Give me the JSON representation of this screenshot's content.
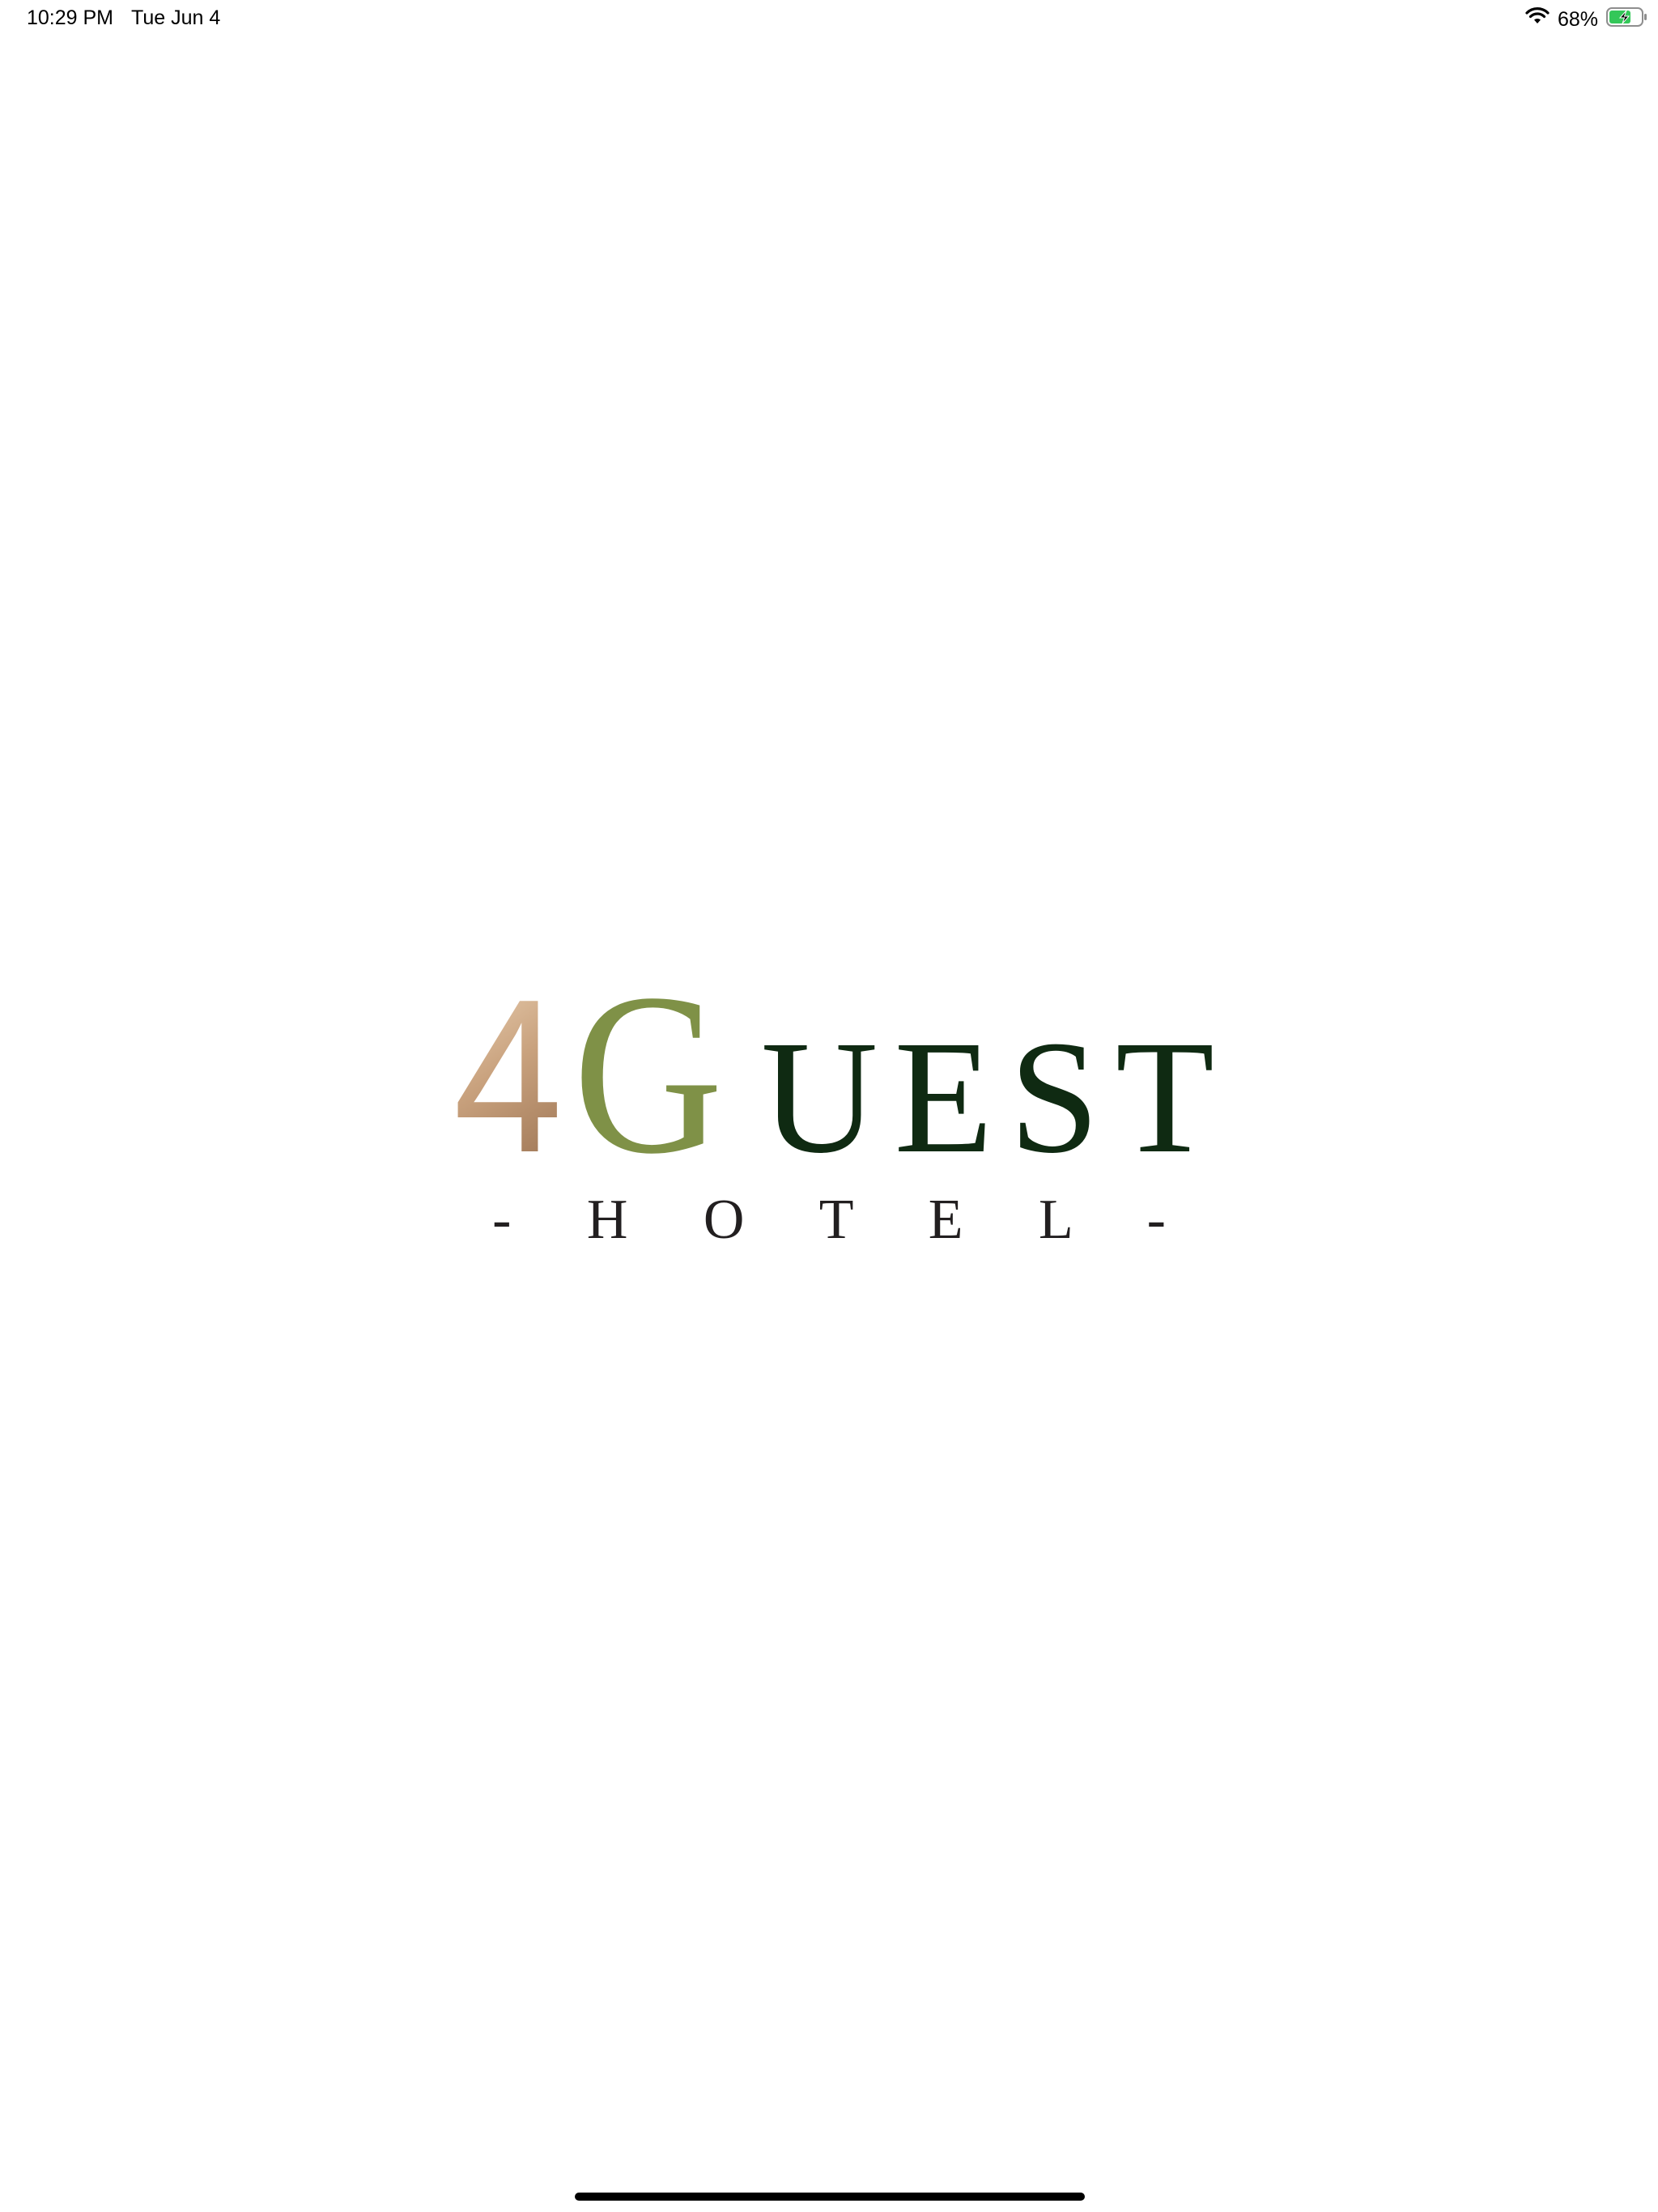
{
  "status_bar": {
    "time": "10:29 PM",
    "date": "Tue Jun 4",
    "battery_percent": "68%",
    "battery_level": 0.68,
    "wifi_icon": "wifi-icon",
    "battery_icon": "battery-charging-icon"
  },
  "logo": {
    "digit": "4",
    "initial": "G",
    "rest": "UEST",
    "subtitle": "- H O T E L -",
    "colors": {
      "digit_gradient": [
        "#f2dcc0",
        "#c9a27e",
        "#a37b5a"
      ],
      "initial": "#7f9147",
      "rest": "#0f2a12",
      "subtitle": "#221f20"
    }
  }
}
